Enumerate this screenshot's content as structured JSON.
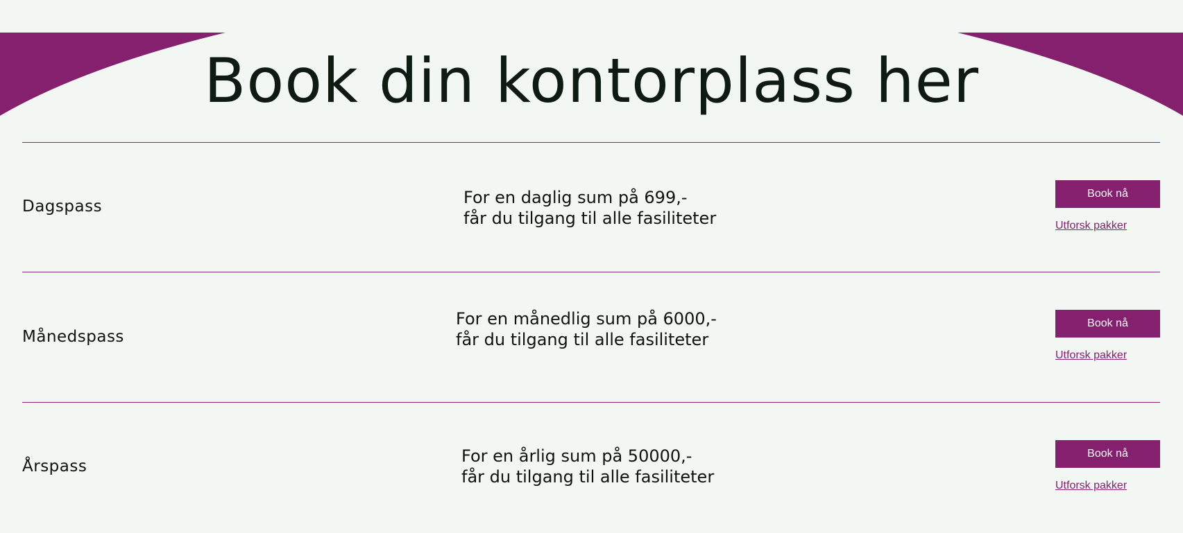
{
  "page": {
    "title": "Book din kontorplass her",
    "accent_color": "#84206e",
    "background_color": "#f2f7f3"
  },
  "passes": [
    {
      "name": "Dagspass",
      "desc_line1": "For en daglig sum på 699,-",
      "desc_line2": "får du tilgang til alle fasiliteter",
      "book_label": "Book nå",
      "explore_label": "Utforsk pakker"
    },
    {
      "name": "Månedspass",
      "desc_line1": "For en månedlig sum på 6000,-",
      "desc_line2": "får du tilgang til alle fasiliteter",
      "book_label": "Book nå",
      "explore_label": "Utforsk pakker"
    },
    {
      "name": "Årspass",
      "desc_line1": "For en årlig sum på 50000,-",
      "desc_line2": "får du tilgang til alle fasiliteter",
      "book_label": "Book nå",
      "explore_label": "Utforsk pakker"
    }
  ]
}
